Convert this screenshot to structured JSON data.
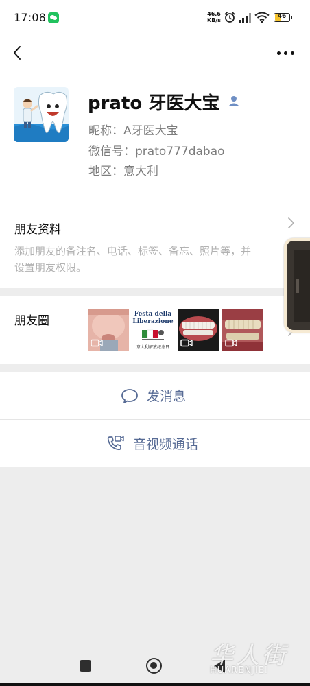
{
  "status_bar": {
    "time": "17:08",
    "net_speed_value": "46.6",
    "net_speed_unit": "KB/s",
    "battery_level": "46",
    "icons": [
      "wechat-notification-icon",
      "alarm-icon",
      "signal-icon",
      "wifi-icon",
      "battery-icon"
    ]
  },
  "header": {
    "back_icon": "chevron-left-icon",
    "more_icon": "more-dots-icon"
  },
  "profile": {
    "name": "prato 牙医大宝",
    "name_icon": "contact-person-icon",
    "nickname": "昵称：A牙医大宝",
    "wechat_id": "微信号：prato777dabao",
    "region": "地区：意大利",
    "avatar": "tooth-cartoon-avatar"
  },
  "friend_info": {
    "title": "朋友资料",
    "description_line1": "添加朋友的备注名、电话、标签、备忘、照片等，并",
    "description_line2": "设置朋友权限。"
  },
  "moments": {
    "title": "朋友圈",
    "thumbnails": [
      {
        "name": "face-photo",
        "is_video": true
      },
      {
        "name": "festa-liberazione-poster",
        "is_video": false,
        "text1": "Festa della",
        "text2": "Liberazione",
        "text3": "意大利解放纪念日"
      },
      {
        "name": "teeth-photo-1",
        "is_video": true
      },
      {
        "name": "teeth-photo-2",
        "is_video": true
      }
    ]
  },
  "actions": {
    "send_message": "发消息",
    "send_message_icon": "chat-bubble-icon",
    "av_call": "音视频通话",
    "av_call_icon": "phone-video-icon"
  },
  "watermark": {
    "cn": "华人街",
    "en": "HUARENJIEI"
  },
  "colors": {
    "link_blue": "#576b95",
    "background_gray": "#ededed",
    "secondary_text": "#7d7d7d",
    "hint_text": "#b2b2b2"
  }
}
